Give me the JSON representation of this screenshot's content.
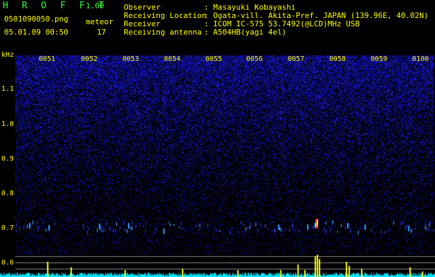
{
  "header": {
    "app_title": "H R O F F T",
    "version": "1.00",
    "filename": "0501090050.png",
    "meteor_label": "meteor",
    "datetime": "05.01.09 00:50",
    "meteor_count": "17"
  },
  "info": [
    {
      "key": "Observer",
      "value": ": Masayuki Kobayashi"
    },
    {
      "key": "Receiving Location",
      "value": ": Ogata-vill. Akita-Pref. JAPAN (139.96E, 40.02N)"
    },
    {
      "key": "Receiver",
      "value": ": ICOM IC-575 53.7492(@LCD)MHz USB"
    },
    {
      "key": "Receiving antenna",
      "value": ": A504HB(yagi 4el)"
    }
  ],
  "axis": {
    "unit": "kHz",
    "freq_labels": [
      "1.1",
      "1.0",
      "0.9",
      "0.8",
      "0.7",
      "0.6"
    ],
    "time_labels": [
      "0051",
      "0052",
      "0053",
      "0054",
      "0055",
      "0056",
      "0057",
      "0058",
      "0059",
      "0100"
    ]
  },
  "colors": {
    "noise": "#1a1ad6",
    "label": "#ffff00",
    "title": "#3cff3c",
    "trace": "#00e5ff"
  }
}
